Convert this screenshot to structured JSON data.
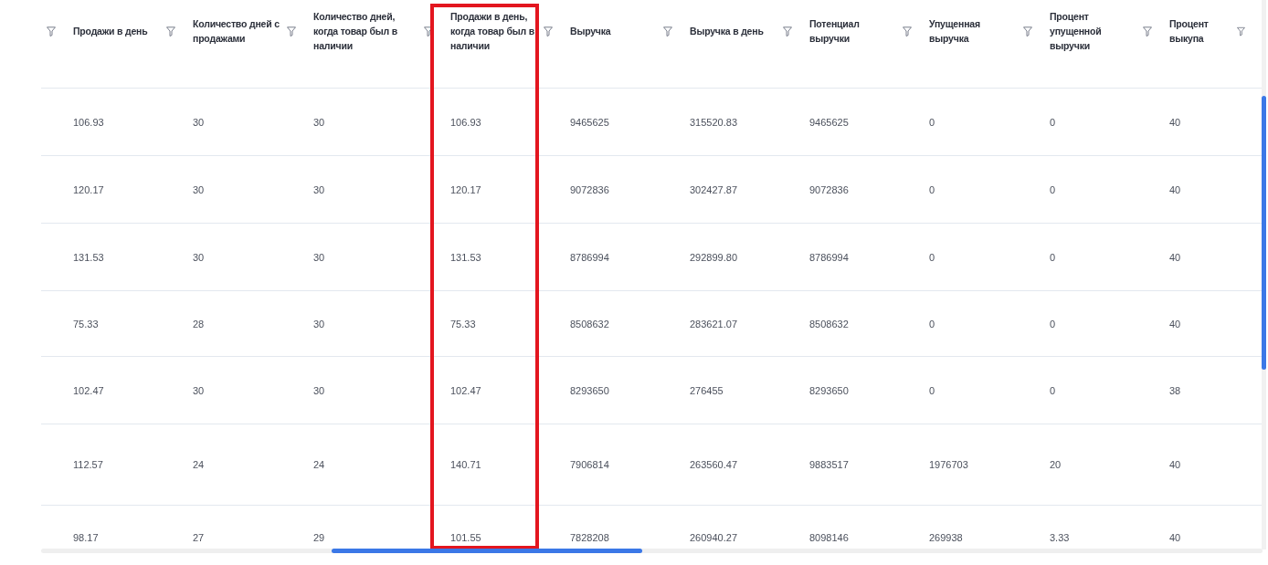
{
  "table": {
    "columns": [
      {
        "label": "Продажи в день",
        "highlighted": false
      },
      {
        "label": "Количество дней с продажами",
        "highlighted": false
      },
      {
        "label": "Количество дней, когда товар был в наличии",
        "highlighted": false
      },
      {
        "label": "Продажи в день, когда товар был в наличии",
        "highlighted": true
      },
      {
        "label": "Выручка",
        "highlighted": false
      },
      {
        "label": "Выручка в день",
        "highlighted": false
      },
      {
        "label": "Потенциал выручки",
        "highlighted": false
      },
      {
        "label": "Упущенная выручка",
        "highlighted": false
      },
      {
        "label": "Процент упущенной выручки",
        "highlighted": false
      },
      {
        "label": "Процент выкупа",
        "highlighted": false
      }
    ],
    "rows": [
      {
        "cells": [
          "106.93",
          "30",
          "30",
          "106.93",
          "9465625",
          "315520.83",
          "9465625",
          "0",
          "0",
          "40"
        ]
      },
      {
        "cells": [
          "120.17",
          "30",
          "30",
          "120.17",
          "9072836",
          "302427.87",
          "9072836",
          "0",
          "0",
          "40"
        ]
      },
      {
        "cells": [
          "131.53",
          "30",
          "30",
          "131.53",
          "8786994",
          "292899.80",
          "8786994",
          "0",
          "0",
          "40"
        ]
      },
      {
        "cells": [
          "75.33",
          "28",
          "30",
          "75.33",
          "8508632",
          "283621.07",
          "8508632",
          "0",
          "0",
          "40"
        ]
      },
      {
        "cells": [
          "102.47",
          "30",
          "30",
          "102.47",
          "8293650",
          "276455",
          "8293650",
          "0",
          "0",
          "38"
        ]
      },
      {
        "cells": [
          "112.57",
          "24",
          "24",
          "140.71",
          "7906814",
          "263560.47",
          "9883517",
          "1976703",
          "20",
          "40"
        ]
      },
      {
        "cells": [
          "98.17",
          "27",
          "29",
          "101.55",
          "7828208",
          "260940.27",
          "8098146",
          "269938",
          "3.33",
          "40"
        ]
      }
    ]
  }
}
